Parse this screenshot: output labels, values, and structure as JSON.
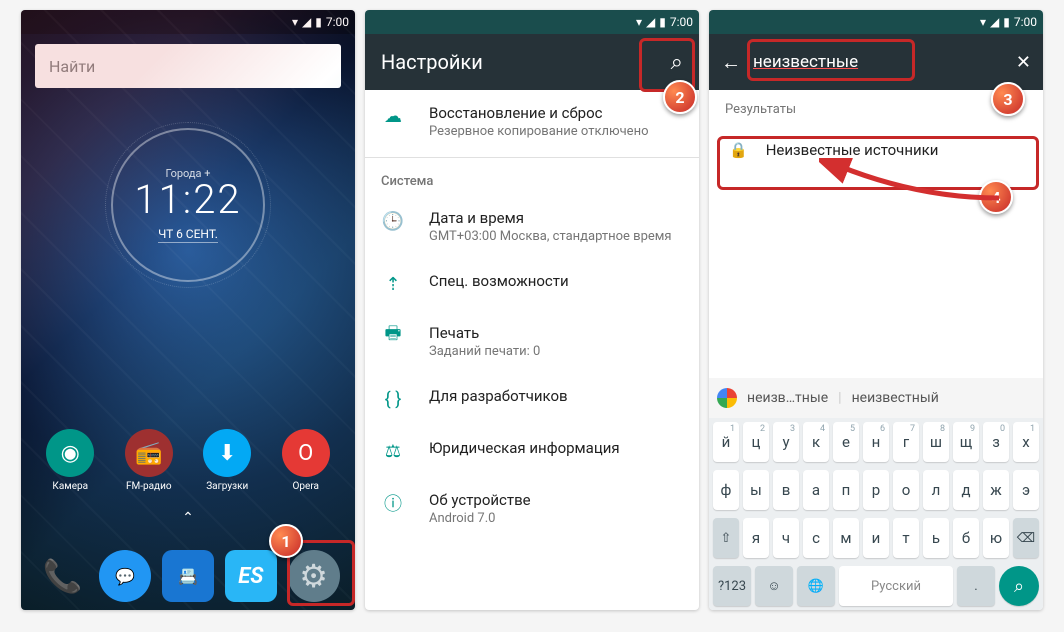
{
  "status": {
    "time": "7:00"
  },
  "p1": {
    "search": "Найти",
    "city": "Города +",
    "time": "11:22",
    "date": "ЧТ 6 СЕНТ.",
    "apps": [
      {
        "label": "Камера",
        "color": "#009688",
        "glyph": "◉"
      },
      {
        "label": "FM-радио",
        "color": "#9e3030",
        "glyph": "📻"
      },
      {
        "label": "Загрузки",
        "color": "#03a9f4",
        "glyph": "⬇"
      },
      {
        "label": "Opera",
        "color": "#e53935",
        "glyph": "O"
      }
    ]
  },
  "p2": {
    "title": "Настройки",
    "items": [
      {
        "icon": "☁",
        "title": "Восстановление и сброс",
        "sub": "Резервное копирование отключено"
      }
    ],
    "section": "Система",
    "sys": [
      {
        "icon": "🕒",
        "title": "Дата и время",
        "sub": "GMT+03:00 Москва, стандартное время"
      },
      {
        "icon": "⇡",
        "title": "Спец. возможности",
        "sub": ""
      },
      {
        "icon": "🖶",
        "title": "Печать",
        "sub": "Заданий печати: 0"
      },
      {
        "icon": "{ }",
        "title": "Для разработчиков",
        "sub": ""
      },
      {
        "icon": "⚖",
        "title": "Юридическая информация",
        "sub": ""
      },
      {
        "icon": "ⓘ",
        "title": "Об устройстве",
        "sub": "Android 7.0"
      }
    ]
  },
  "p3": {
    "query": "неизвестные",
    "results_label": "Результаты",
    "result": "Неизвестные источники",
    "suggestions": [
      "неизв…тные",
      "неизвестный"
    ],
    "rows": [
      [
        "й",
        "ц",
        "у",
        "к",
        "е",
        "н",
        "г",
        "ш",
        "щ",
        "з",
        "х"
      ],
      [
        "ф",
        "ы",
        "в",
        "а",
        "п",
        "р",
        "о",
        "л",
        "д",
        "ж",
        "э"
      ]
    ],
    "row3": [
      "я",
      "ч",
      "с",
      "м",
      "и",
      "т",
      "ь",
      "б",
      "ю"
    ],
    "space": "Русский",
    "numkey": "?123"
  },
  "badges": [
    "1",
    "2",
    "3",
    "4"
  ]
}
